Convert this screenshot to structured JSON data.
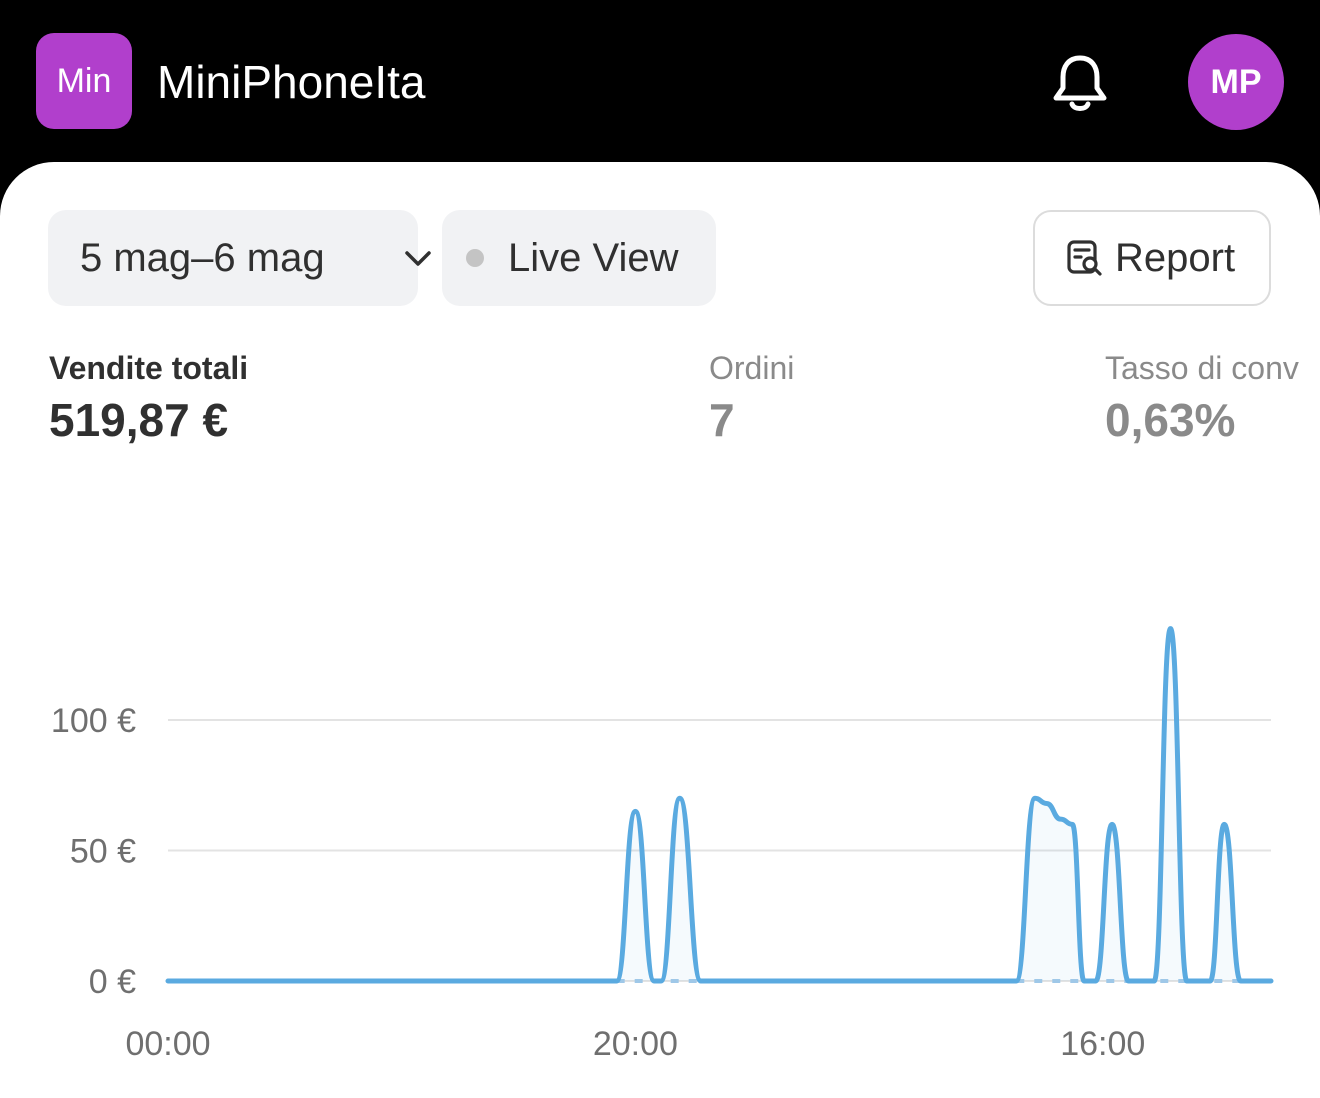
{
  "header": {
    "logo_text": "Min",
    "store_name": "MiniPhoneIta",
    "avatar_initials": "MP",
    "accent_color": "#b13fcc"
  },
  "toolbar": {
    "date_range": "5 mag–6 mag",
    "live_view": "Live View",
    "report": "Report"
  },
  "metrics": [
    {
      "label": "Vendite totali",
      "value": "519,87 €"
    },
    {
      "label": "Ordini",
      "value": "7"
    },
    {
      "label": "Tasso di conv",
      "value": "0,63%"
    }
  ],
  "chart_data": {
    "type": "line",
    "x_tick_labels": [
      "00:00",
      "20:00",
      "16:00"
    ],
    "y_tick_labels": [
      "0 €",
      "50 €",
      "100 €"
    ],
    "ylim": [
      0,
      140
    ],
    "grid": true,
    "line_color": "#5aaae0",
    "series": [
      {
        "values": [
          [
            0,
            0
          ],
          [
            19.2,
            0
          ],
          [
            20,
            65
          ],
          [
            20.8,
            0
          ],
          [
            21.1,
            0
          ],
          [
            21.9,
            70
          ],
          [
            22.8,
            0
          ],
          [
            36.3,
            0
          ],
          [
            37.1,
            70
          ],
          [
            37.6,
            68
          ],
          [
            38.2,
            62
          ],
          [
            38.7,
            60
          ],
          [
            39.2,
            0
          ],
          [
            39.7,
            0
          ],
          [
            40.4,
            60
          ],
          [
            41.1,
            0
          ],
          [
            42.2,
            0
          ],
          [
            42.9,
            135
          ],
          [
            43.6,
            0
          ],
          [
            44.6,
            0
          ],
          [
            45.2,
            60
          ],
          [
            45.9,
            0
          ],
          [
            47.2,
            0
          ]
        ]
      },
      {
        "style": "dashed",
        "values": [
          [
            19.2,
            0
          ],
          [
            22.8,
            0
          ],
          [
            36.3,
            0
          ],
          [
            47.2,
            0
          ]
        ]
      }
    ]
  }
}
